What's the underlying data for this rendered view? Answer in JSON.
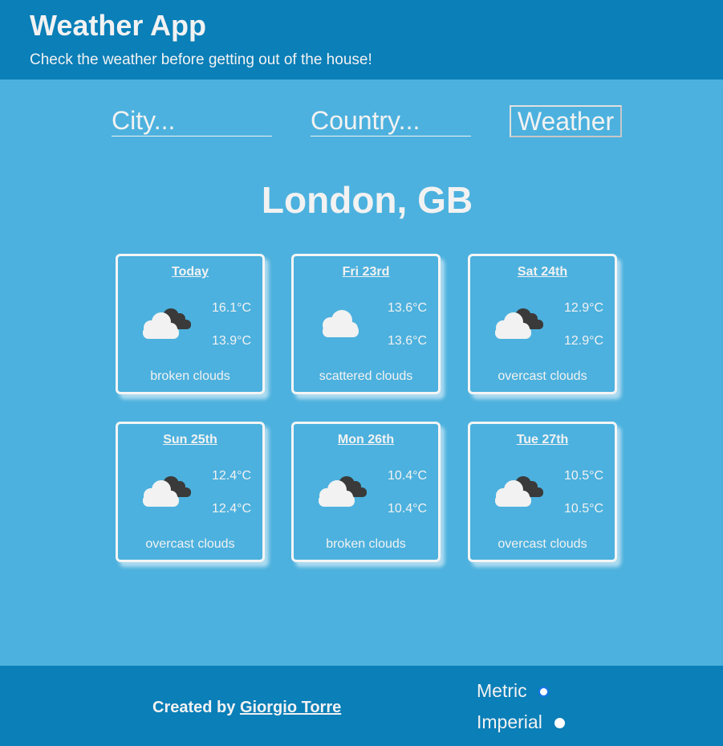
{
  "header": {
    "title": "Weather App",
    "subtitle": "Check the weather before getting out of the house!"
  },
  "search": {
    "city_placeholder": "City...",
    "country_placeholder": "Country...",
    "button_label": "Weather"
  },
  "location": "London, GB",
  "forecast": [
    {
      "day": "Today",
      "icon": "broken-clouds-icon",
      "max": "16.1°C",
      "min": "13.9°C",
      "desc": "broken clouds"
    },
    {
      "day": "Fri 23rd",
      "icon": "scattered-clouds-icon",
      "max": "13.6°C",
      "min": "13.6°C",
      "desc": "scattered clouds"
    },
    {
      "day": "Sat 24th",
      "icon": "overcast-clouds-icon",
      "max": "12.9°C",
      "min": "12.9°C",
      "desc": "overcast clouds"
    },
    {
      "day": "Sun 25th",
      "icon": "overcast-clouds-icon",
      "max": "12.4°C",
      "min": "12.4°C",
      "desc": "overcast clouds"
    },
    {
      "day": "Mon 26th",
      "icon": "broken-clouds-icon",
      "max": "10.4°C",
      "min": "10.4°C",
      "desc": "broken clouds"
    },
    {
      "day": "Tue 27th",
      "icon": "overcast-clouds-icon",
      "max": "10.5°C",
      "min": "10.5°C",
      "desc": "overcast clouds"
    }
  ],
  "footer": {
    "credit_prefix": "Created by ",
    "author": "Giorgio Torre",
    "units": {
      "metric": "Metric",
      "imperial": "Imperial",
      "selected": "metric"
    }
  },
  "colors": {
    "background": "#4cb1de",
    "header_footer": "#0a7fb8",
    "text": "#f2f2f2"
  }
}
